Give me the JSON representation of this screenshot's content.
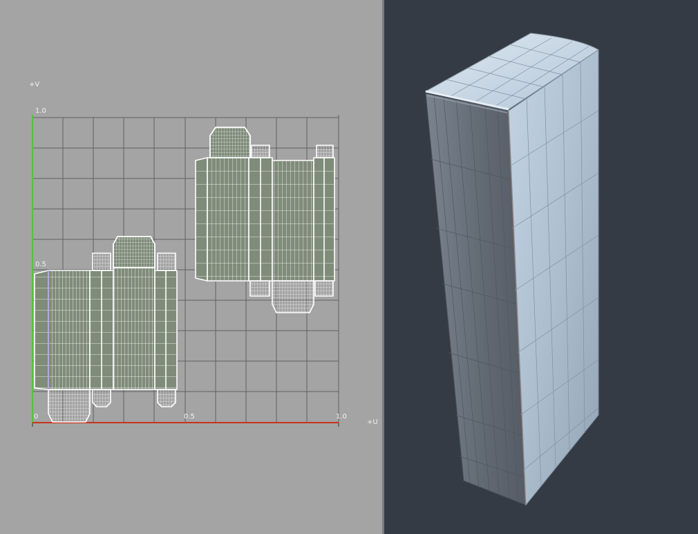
{
  "uv_editor": {
    "axis_v_label": "+V",
    "axis_u_label": "+U",
    "tick_v_top": "1.0",
    "tick_v_mid": "0.5",
    "tick_origin": "0",
    "tick_u_mid": "0.5",
    "tick_u_right": "1.0"
  },
  "colors": {
    "uv_background": "#a4a4a4",
    "viewport_background": "#353b44",
    "grid_line": "#5e5e5e",
    "u_axis": "#c8331f",
    "v_axis": "#55c23a",
    "uv_island_fill": "#7f8c7a",
    "uv_wire": "#ffffff",
    "model_light_face": "#b9cbdc",
    "model_dark_face": "#6f7782"
  }
}
